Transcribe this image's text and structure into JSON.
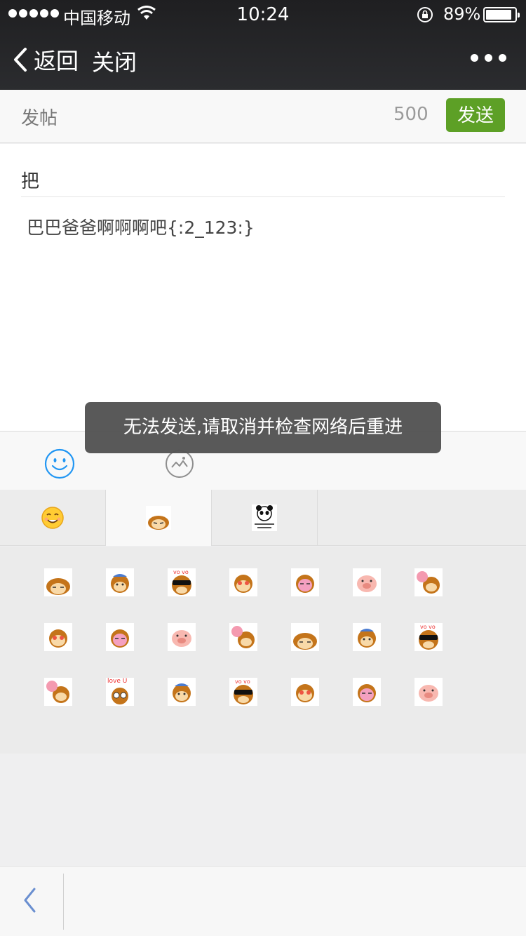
{
  "status_bar": {
    "carrier": "中国移动",
    "time": "10:24",
    "battery_percent": "89%",
    "battery_level": 0.89,
    "signal_dots": 5
  },
  "nav": {
    "back_label": "返回",
    "close_label": "关闭"
  },
  "compose": {
    "title": "发帖",
    "char_count": "500",
    "send_label": "发送"
  },
  "editor": {
    "title_value": "把",
    "content": "巴巴爸爸啊啊啊吧{:2_123:}"
  },
  "toolbar": {
    "emoji_icon": "smiley-icon",
    "image_icon": "image-icon"
  },
  "emoji_tabs": [
    {
      "name": "smiley-face-tab",
      "active": false
    },
    {
      "name": "monkey-tab",
      "active": true
    },
    {
      "name": "panda-meme-tab",
      "active": false
    }
  ],
  "emoji_grid": {
    "rows": 3,
    "cols": 7,
    "love_label": "love U"
  },
  "toast": {
    "message": "无法发送,请取消并检查网络后重进"
  },
  "colors": {
    "accent_green": "#5da026",
    "icon_blue": "#2196f3",
    "monkey_brown": "#c4741a"
  }
}
